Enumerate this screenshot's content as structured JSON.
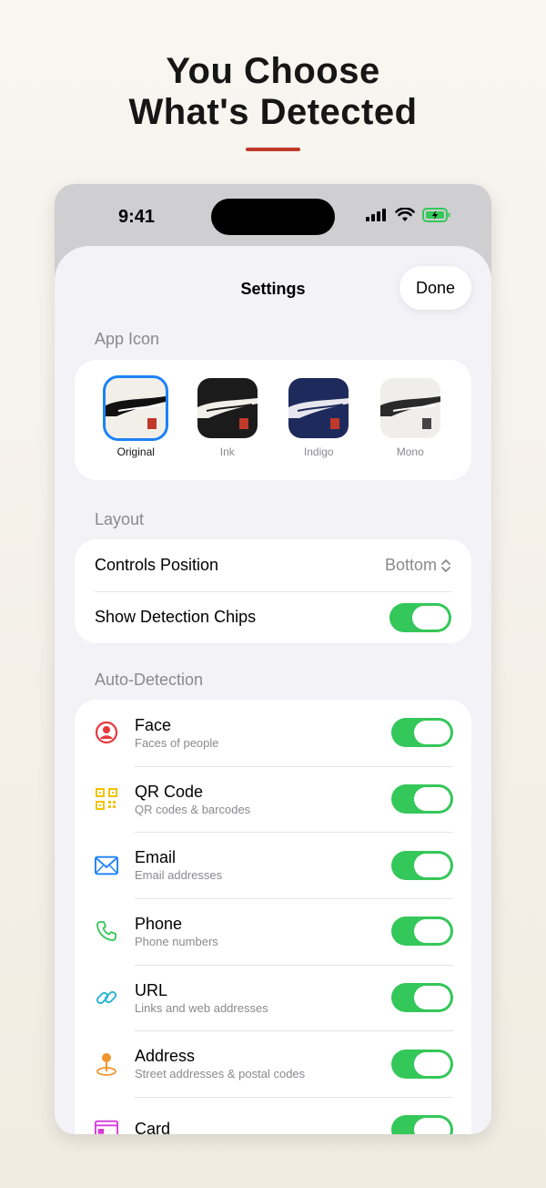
{
  "headline": {
    "line1": "You Choose",
    "line2": "What's Detected"
  },
  "status": {
    "time": "9:41"
  },
  "sheet": {
    "title": "Settings",
    "done": "Done"
  },
  "app_icon": {
    "header": "App Icon",
    "options": [
      {
        "label": "Original",
        "selected": true
      },
      {
        "label": "Ink",
        "selected": false
      },
      {
        "label": "Indigo",
        "selected": false
      },
      {
        "label": "Mono",
        "selected": false
      }
    ]
  },
  "layout": {
    "header": "Layout",
    "controls_position": {
      "label": "Controls Position",
      "value": "Bottom"
    },
    "show_detection_chips": {
      "label": "Show Detection Chips",
      "on": true
    }
  },
  "auto_detection": {
    "header": "Auto-Detection",
    "items": [
      {
        "title": "Face",
        "subtitle": "Faces of people",
        "icon": "face-icon",
        "on": true
      },
      {
        "title": "QR Code",
        "subtitle": "QR codes & barcodes",
        "icon": "qr-code-icon",
        "on": true
      },
      {
        "title": "Email",
        "subtitle": "Email addresses",
        "icon": "envelope-icon",
        "on": true
      },
      {
        "title": "Phone",
        "subtitle": "Phone numbers",
        "icon": "phone-icon",
        "on": true
      },
      {
        "title": "URL",
        "subtitle": "Links and web addresses",
        "icon": "link-icon",
        "on": true
      },
      {
        "title": "Address",
        "subtitle": "Street addresses & postal codes",
        "icon": "map-pin-icon",
        "on": true
      },
      {
        "title": "Card",
        "subtitle": "",
        "icon": "card-icon",
        "on": true
      }
    ]
  },
  "colors": {
    "accent": "#c0392b",
    "toggle_on": "#34c759",
    "selection": "#1c82f6"
  }
}
